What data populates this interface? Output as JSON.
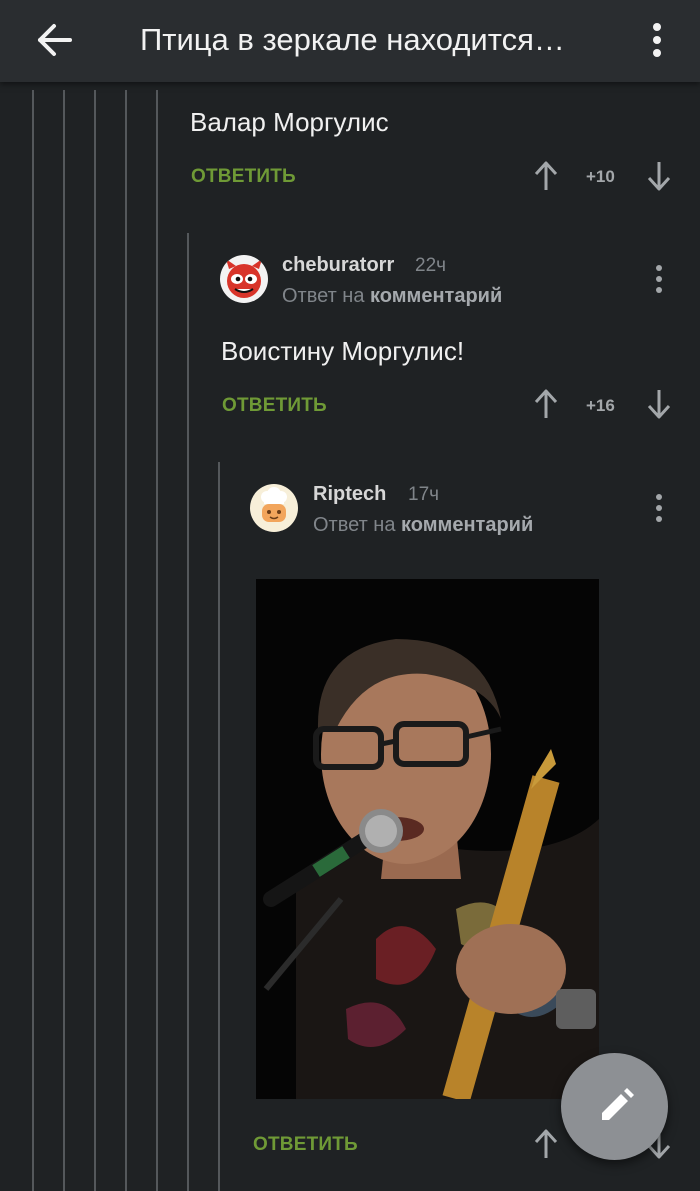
{
  "header": {
    "title": "Птица в зеркале находится…",
    "back_icon": "arrow-left-icon",
    "menu_icon": "more-vertical-icon"
  },
  "comments": [
    {
      "text": "Валар Моргулис",
      "reply_label": "ОТВЕТИТЬ",
      "score": "+10"
    },
    {
      "username": "cheburatorr",
      "time": "22ч",
      "reply_to_prefix": "Ответ на",
      "reply_to_link": "комментарий",
      "text": "Воистину Моргулис!",
      "reply_label": "ОТВЕТИТЬ",
      "score": "+16"
    },
    {
      "username": "Riptech",
      "time": "17ч",
      "reply_to_prefix": "Ответ на",
      "reply_to_link": "комментарий",
      "reply_label": "ОТВЕТИТЬ"
    }
  ],
  "colors": {
    "background": "#1f2224",
    "topbar": "#2a2d30",
    "reply_green": "#6f9a36",
    "fab": "#8d9094"
  },
  "fab": {
    "icon": "pencil-icon"
  }
}
